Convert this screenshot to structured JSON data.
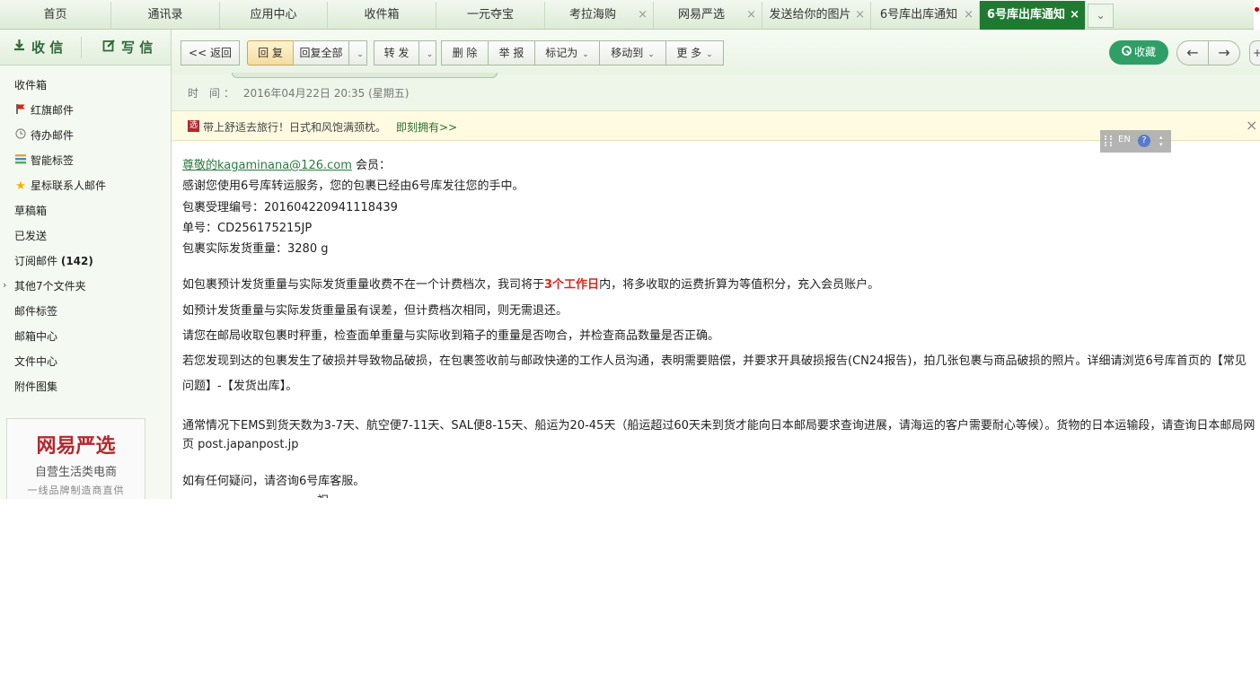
{
  "tabs": [
    {
      "label": "首页",
      "closable": false,
      "active": false
    },
    {
      "label": "通讯录",
      "closable": false,
      "active": false
    },
    {
      "label": "应用中心",
      "closable": false,
      "active": false
    },
    {
      "label": "收件箱",
      "closable": false,
      "active": false
    },
    {
      "label": "一元夺宝",
      "closable": false,
      "active": false
    },
    {
      "label": "考拉海购",
      "closable": true,
      "active": false
    },
    {
      "label": "网易严选",
      "closable": true,
      "active": false
    },
    {
      "label": "发送给你的图片",
      "closable": true,
      "active": false
    },
    {
      "label": "6号库出库通知",
      "closable": true,
      "active": false
    },
    {
      "label": "6号库出库通知",
      "closable": true,
      "active": true
    }
  ],
  "tab_close_glyph": "×",
  "tab_more_glyph": "⌄",
  "sidebar": {
    "receive_label": "收 信",
    "write_label": "写 信",
    "folders": [
      {
        "label": "收件箱",
        "icon": ""
      },
      {
        "label": "红旗邮件",
        "icon": "red-flag-icon"
      },
      {
        "label": "待办邮件",
        "icon": "clock-icon"
      },
      {
        "label": "智能标签",
        "icon": "tags-icon"
      },
      {
        "label": "星标联系人邮件",
        "icon": "star-icon"
      },
      {
        "label": "草稿箱",
        "icon": ""
      },
      {
        "label": "已发送",
        "icon": ""
      },
      {
        "label": "订阅邮件",
        "icon": "",
        "count": "(142)"
      },
      {
        "label": "其他7个文件夹",
        "icon": "",
        "expandable": true
      },
      {
        "label": "邮件标签",
        "icon": ""
      },
      {
        "label": "邮箱中心",
        "icon": ""
      },
      {
        "label": "文件中心",
        "icon": ""
      },
      {
        "label": "附件图集",
        "icon": ""
      }
    ],
    "ad": {
      "brand": "网易严选",
      "line1": "自营生活类电商",
      "line2": "一线品牌制造商直供"
    }
  },
  "toolbar": {
    "back": "<< 返回",
    "reply": "回 复",
    "reply_all": "回复全部",
    "forward": "转 发",
    "delete": "删 除",
    "report": "举 报",
    "mark_as": "标记为",
    "move_to": "移动到",
    "more": "更 多",
    "collect": "收藏",
    "prev_glyph": "←",
    "next_glyph": "→"
  },
  "header": {
    "time_label": "时 间：",
    "time_value": "2016年04月22日 20:35 (星期五)"
  },
  "notice": {
    "icon_text": "选",
    "text": "带上舒适去旅行！日式和风饱满颈枕。",
    "link": "即刻拥有>>",
    "close": "×"
  },
  "ime": {
    "lang": "EN",
    "help": "?"
  },
  "email": {
    "greeting_link": "尊敬的kagaminana@126.com",
    "greeting_rest": " 会员：",
    "thanks": "感谢您使用6号库转运服务，您的包裹已经由6号库发往您的手中。",
    "package_no": "包裹受理编号：201604220941118439",
    "tracking_no": "单号：CD256175215JP",
    "weight": "包裹实际发货重量：3280 g",
    "p1_before": "如包裹预计发货重量与实际发货重量收费不在一个计费档次，我司将于",
    "p1_highlight": "3个工作日",
    "p1_after": "内，将多收取的运费折算为等值积分，充入会员账户。",
    "p2": "如预计发货重量与实际发货重量虽有误差，但计费档次相同，则无需退还。",
    "p3": "请您在邮局收取包裹时秤重，检查面单重量与实际收到箱子的重量是否吻合，并检查商品数量是否正确。",
    "p4": "若您发现到达的包裹发生了破损并导致物品破损，在包裹签收前与邮政快递的工作人员沟通，表明需要赔偿，并要求开具破损报告(CN24报告)，拍几张包裹与商品破损的照片。详细请浏览6号库首页的【常见问题】-【发货出库】。",
    "p5": "通常情况下EMS到货天数为3-7天、航空便7-11天、SAL便8-15天、船运为20-45天（船运超过60天未到货才能向日本邮局要求查询进展，请海运的客户需要耐心等候）。货物的日本运输段，请查询日本邮局网页 post.japanpost.jp",
    "p6": "如有任何疑问，请咨询6号库客服。",
    "p7_partial": "祝"
  }
}
